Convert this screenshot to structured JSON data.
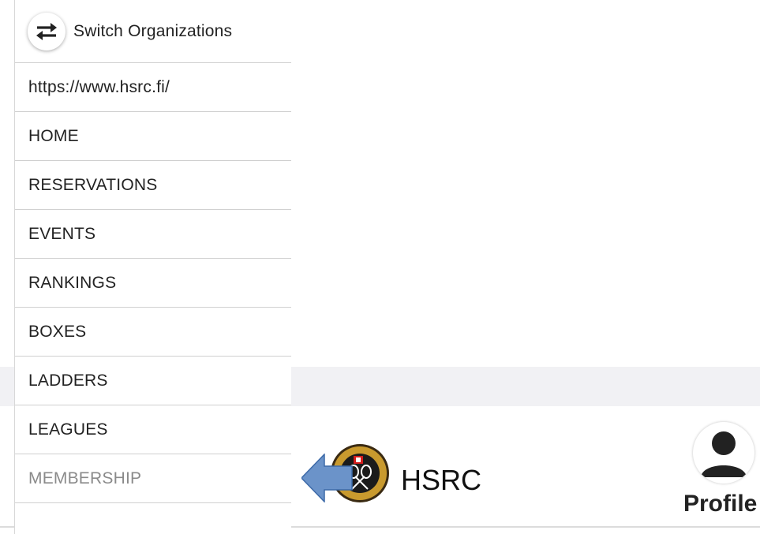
{
  "drawer": {
    "switch_label": "Switch Organizations",
    "switch_icon": "swap-arrows-icon",
    "items": [
      "https://www.hsrc.fi/",
      "HOME",
      "RESERVATIONS",
      "EVENTS",
      "RANKINGS",
      "BOXES",
      "LADDERS",
      "LEAGUES",
      "MEMBERSHIP"
    ],
    "highlighted_item": "MEMBERSHIP"
  },
  "header": {
    "brand": "HSRC",
    "logo_icon": "club-logo-icon",
    "profile_label": "Profile",
    "profile_icon": "user-avatar-icon"
  },
  "annotation": {
    "arrow_icon": "left-arrow-pointer-icon",
    "arrow_color": "#6b93c9"
  },
  "colors": {
    "band": "#f1f1f4",
    "text": "#222222",
    "dim_text": "#8a8a8a"
  }
}
